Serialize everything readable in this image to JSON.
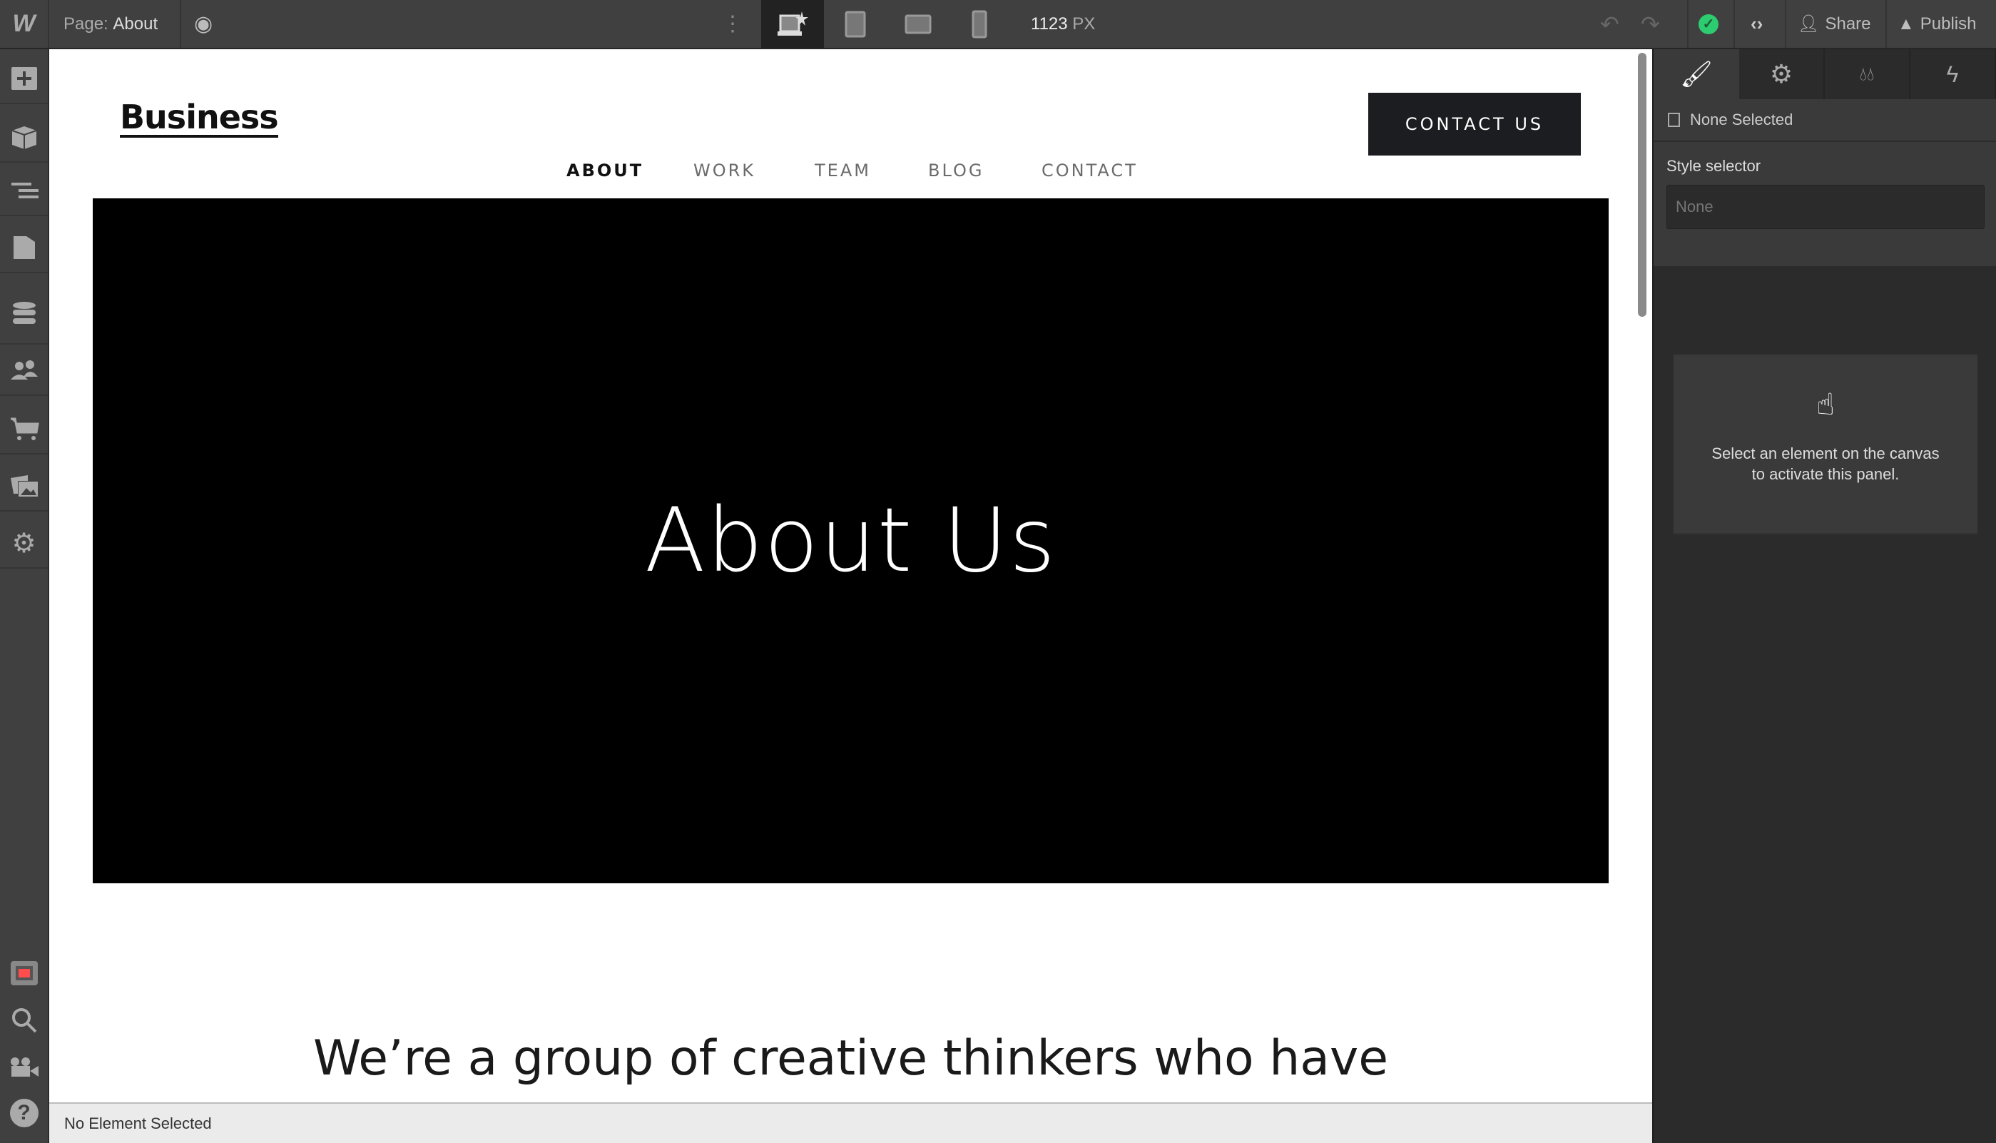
{
  "topbar": {
    "page_label": "Page:",
    "page_name": "About",
    "width_value": "1123",
    "width_unit": "PX",
    "share": "Share",
    "publish": "Publish"
  },
  "site": {
    "logo": "Business",
    "nav": [
      "ABOUT",
      "WORK",
      "TEAM",
      "BLOG",
      "CONTACT"
    ],
    "cta": "CONTACT US",
    "hero_title": "About Us",
    "intro": "We’re a group of creative thinkers who have"
  },
  "panel": {
    "none_selected": "None Selected",
    "style_selector_label": "Style selector",
    "style_selector_placeholder": "None",
    "empty_line1": "Select an element on the canvas",
    "empty_line2": "to activate this panel."
  },
  "status": {
    "text": "No Element Selected"
  },
  "colors": {
    "accent_green": "#2ecc71",
    "record_red": "#ff4d4d"
  }
}
